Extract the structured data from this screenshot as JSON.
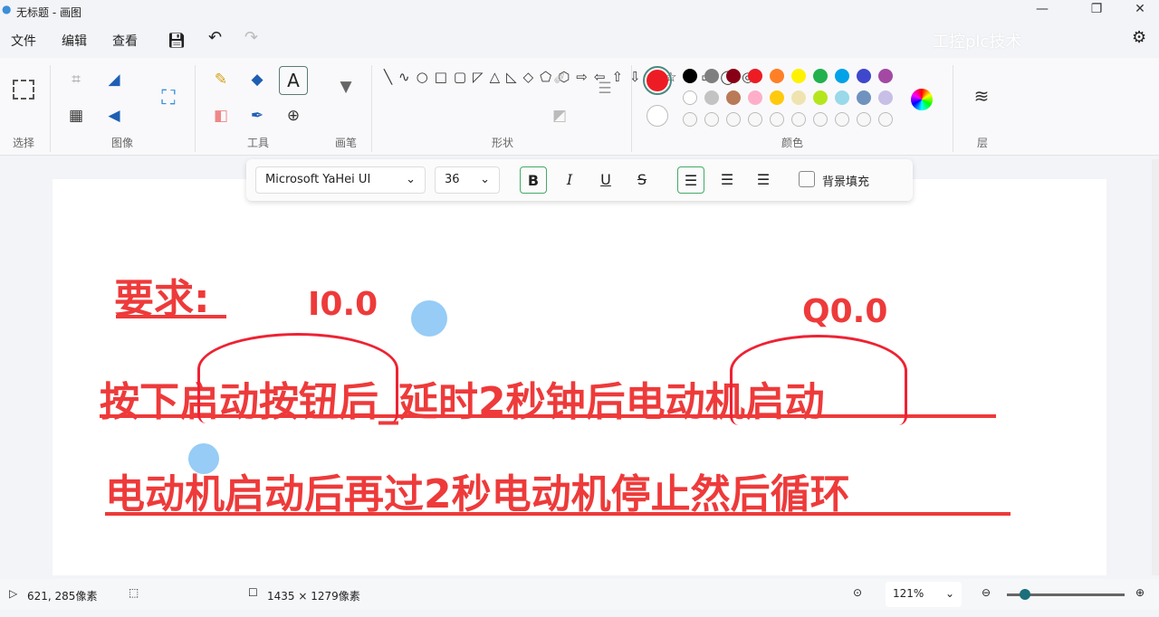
{
  "window": {
    "title": "无标题 - 画图",
    "watermark": "工控plc技术",
    "min": "—",
    "max": "❐",
    "close": "✕"
  },
  "menu": {
    "file": "文件",
    "edit": "编辑",
    "view": "查看"
  },
  "ribbon": {
    "select": "选择",
    "image": "图像",
    "tools": "工具",
    "brush": "画笔",
    "shapes": "形状",
    "colors": "颜色",
    "layers": "层"
  },
  "palette": {
    "primary": "#ed1c24",
    "secondary": "#ffffff",
    "row1": [
      "#000000",
      "#7f7f7f",
      "#880015",
      "#ed1c24",
      "#ff7f27",
      "#fff200",
      "#22b14c",
      "#00a2e8",
      "#3f48cc",
      "#a349a4"
    ],
    "row2": [
      "#ffffff",
      "#c3c3c3",
      "#b97a57",
      "#ffaec9",
      "#ffc90e",
      "#efe4b0",
      "#b5e61d",
      "#99d9ea",
      "#7092be",
      "#c8bfe7"
    ]
  },
  "textbar": {
    "font": "Microsoft YaHei UI",
    "size": "36",
    "bold": "B",
    "italic": "I",
    "underline": "U",
    "strike": "S",
    "bg_fill": "背景填充"
  },
  "canvas": {
    "heading": "要求:",
    "label1": "I0.0",
    "label2": "Q0.0",
    "line1": "按下启动按钮后_延时2秒钟后电动机启动",
    "line2": "电动机启动后再过2秒电动机停止然后循环"
  },
  "status": {
    "cursor": "621, 285像素",
    "size": "1435 × 1279像素",
    "zoom": "121%"
  }
}
